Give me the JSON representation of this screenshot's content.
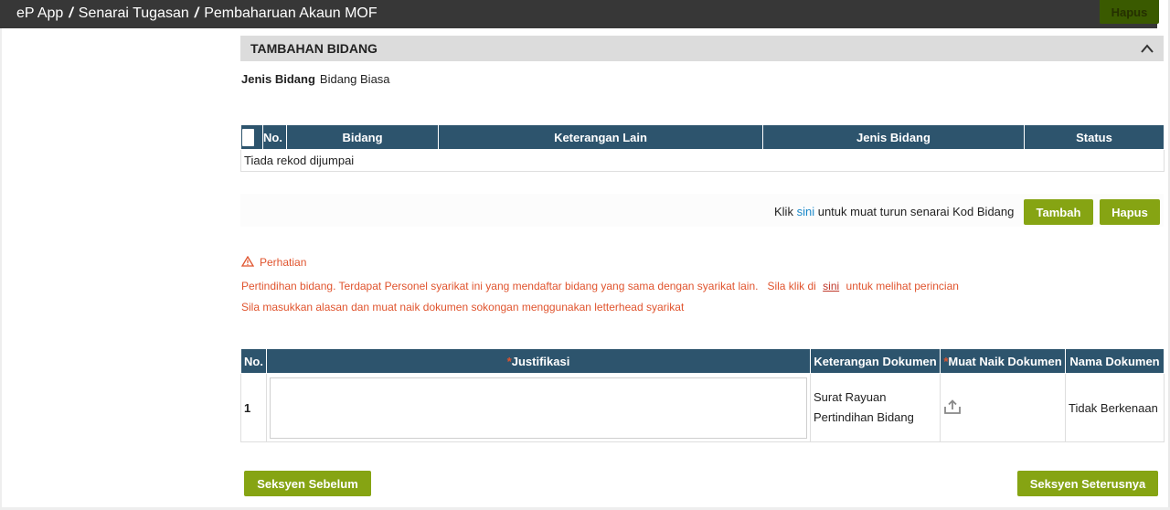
{
  "breadcrumb": {
    "app": "eP App",
    "sep": "/",
    "list": "Senarai Tugasan",
    "current": "Pembaharuan Akaun MOF"
  },
  "top_button": {
    "label": "Hapus"
  },
  "panel": {
    "title": "TAMBAHAN BIDANG",
    "toggle_icon": "chevron-up-icon"
  },
  "jenis": {
    "label": "Jenis Bidang",
    "value": "Bidang Biasa"
  },
  "bidang_table": {
    "headers": [
      "No.",
      "Bidang",
      "Keterangan Lain",
      "Jenis Bidang",
      "Status"
    ],
    "empty_text": "Tiada rekod dijumpai"
  },
  "actions": {
    "pre": "Klik",
    "link": "sini",
    "post": "untuk muat turun senarai Kod Bidang",
    "tambah": "Tambah",
    "hapus": "Hapus"
  },
  "warning": {
    "icon": "warning-triangle-icon",
    "title": "Perhatian",
    "line1_pre": "Pertindihan bidang. Terdapat Personel syarikat ini yang mendaftar bidang yang sama dengan syarikat lain.   Sila klik di",
    "line1_link": "sini",
    "line1_post": "untuk melihat perincian",
    "line2": "Sila masukkan alasan dan muat naik dokumen sokongan menggunakan letterhead syarikat"
  },
  "justifikasi_table": {
    "headers": {
      "no": "No.",
      "justifikasi": "Justifikasi",
      "keterangan": "Keterangan Dokumen",
      "muat_naik": "Muat Naik Dokumen",
      "nama": "Nama Dokumen"
    },
    "required_mark": "*",
    "rows": [
      {
        "no": "1",
        "justifikasi": "",
        "keterangan": "Surat Rayuan Pertindihan Bidang",
        "upload_icon": "upload-icon",
        "nama": "Tidak Berkenaan"
      }
    ]
  },
  "nav": {
    "prev": "Seksyen Sebelum",
    "next": "Seksyen Seterusnya"
  },
  "colors": {
    "header": "#2d546d",
    "button": "#86a413",
    "warning": "#e0542e",
    "link": "#1a88c9",
    "topbar": "#373737"
  }
}
